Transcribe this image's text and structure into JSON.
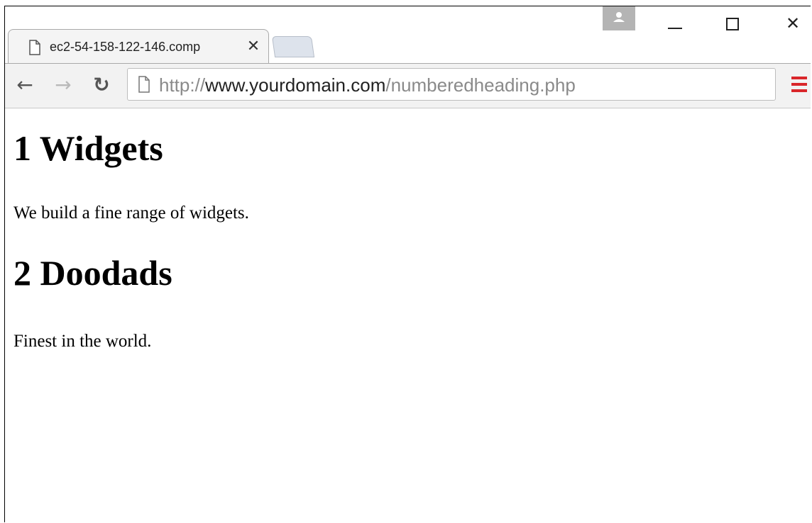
{
  "browser": {
    "tab": {
      "title": "ec2-54-158-122-146.comp",
      "close_glyph": "✕"
    },
    "window_controls": {
      "minimize": "",
      "maximize": "",
      "close": "✕"
    },
    "toolbar": {
      "back_glyph": "←",
      "forward_glyph": "→",
      "reload_glyph": "↻"
    },
    "address_bar": {
      "scheme": "http://",
      "host": "www.yourdomain.com",
      "path": "/numberedheading.php"
    },
    "colors": {
      "menu_accent": "#d9262a",
      "tab_bg": "#f4f4f4",
      "toolbar_bg": "#f2f2f2"
    },
    "icons": [
      "page-icon",
      "close-icon",
      "back-arrow-icon",
      "forward-arrow-icon",
      "reload-icon",
      "profile-icon",
      "minimize-icon",
      "maximize-icon",
      "window-close-icon",
      "menu-icon"
    ]
  },
  "page": {
    "sections": [
      {
        "heading": "1 Widgets",
        "text": "We build a fine range of widgets."
      },
      {
        "heading": "2 Doodads",
        "text": "Finest in the world."
      }
    ]
  }
}
